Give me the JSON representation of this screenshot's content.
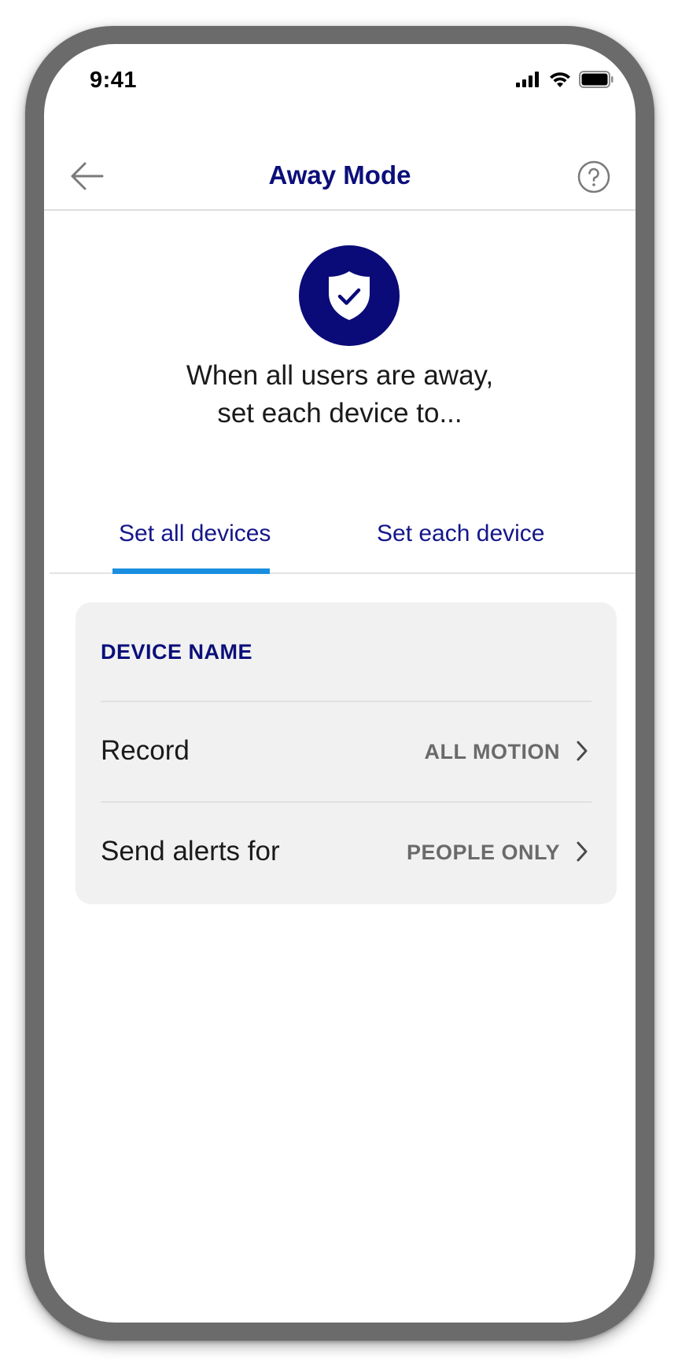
{
  "status_bar": {
    "time": "9:41"
  },
  "header": {
    "title": "Away Mode",
    "back_icon": "arrow-left-icon",
    "help_icon": "question-circle-icon"
  },
  "hero": {
    "icon": "shield-check-icon",
    "line1": "When all users are away,",
    "line2": "set each device to..."
  },
  "tabs": [
    {
      "label": "Set all devices",
      "selected": true
    },
    {
      "label": "Set each device",
      "selected": false
    }
  ],
  "card": {
    "title": "DEVICE NAME",
    "rows": [
      {
        "label": "Record",
        "value": "ALL MOTION"
      },
      {
        "label": "Send alerts for",
        "value": "PEOPLE ONLY"
      }
    ]
  },
  "colors": {
    "brand_navy": "#0a0b78",
    "tab_indicator": "#1a8fe0",
    "card_bg": "#f1f1f1",
    "device_frame": "#6b6b6b"
  }
}
